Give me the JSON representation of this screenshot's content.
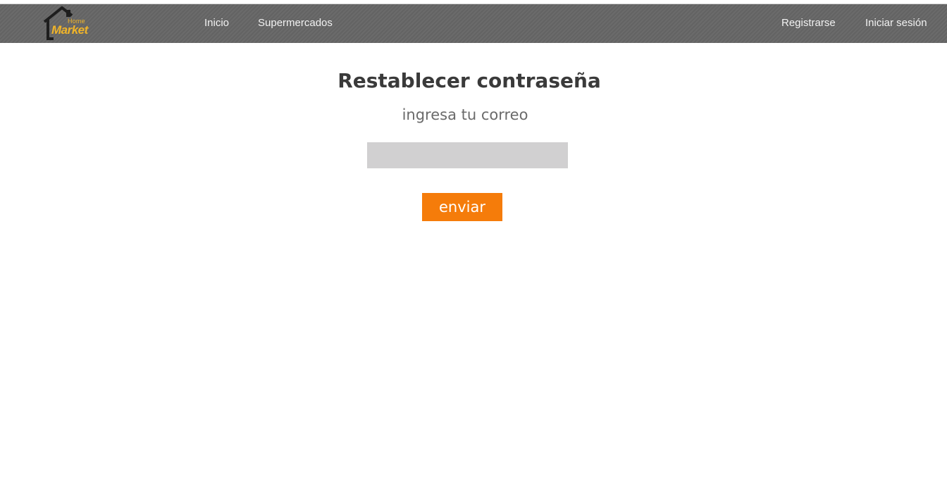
{
  "brand": {
    "logo_top": "Home",
    "logo_main": "Market",
    "accent_color": "#f0b429"
  },
  "nav": {
    "left": [
      {
        "label": "Inicio"
      },
      {
        "label": "Supermercados"
      }
    ],
    "right": [
      {
        "label": "Registrarse"
      },
      {
        "label": "Iniciar sesión"
      }
    ],
    "background_color": "#666666"
  },
  "form": {
    "title": "Restablecer contraseña",
    "subtitle": "ingresa tu correo",
    "email_value": "",
    "email_placeholder": "",
    "submit_label": "enviar",
    "submit_color": "#f57c0a"
  }
}
